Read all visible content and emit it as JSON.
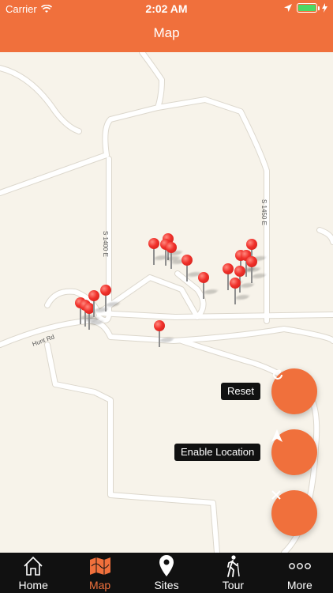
{
  "status_bar": {
    "carrier": "Carrier",
    "time": "2:02 AM"
  },
  "header": {
    "title": "Map"
  },
  "map": {
    "road_labels": {
      "road_1400": "S 1400 E",
      "road_1450": "S 1450 E",
      "hunt_rd": "Hunt Rd"
    }
  },
  "actions": {
    "reset_label": "Reset",
    "location_label": "Enable Location"
  },
  "tabs": [
    {
      "label": "Home",
      "icon": "home-icon",
      "active": false
    },
    {
      "label": "Map",
      "icon": "map-icon",
      "active": true
    },
    {
      "label": "Sites",
      "icon": "location-pin-icon",
      "active": false
    },
    {
      "label": "Tour",
      "icon": "hiker-icon",
      "active": false
    },
    {
      "label": "More",
      "icon": "more-icon",
      "active": false
    }
  ],
  "colors": {
    "accent": "#f0703c",
    "pin": "#f0302a",
    "tabbar": "#111111",
    "map_bg": "#f7f3ea"
  }
}
